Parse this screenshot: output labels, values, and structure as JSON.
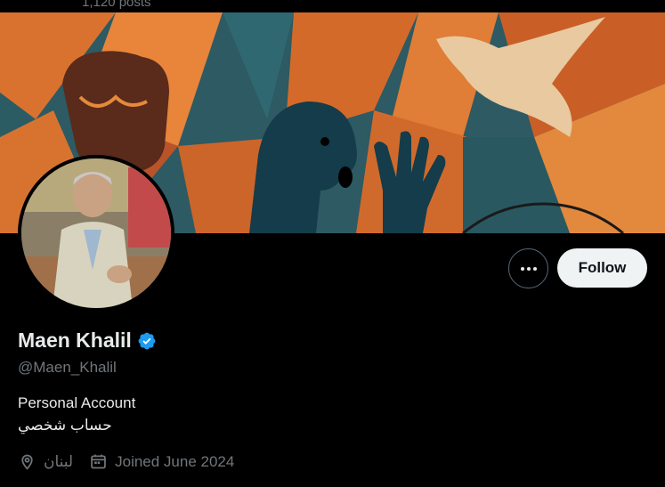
{
  "header": {
    "post_count": "1,120 posts"
  },
  "profile": {
    "display_name": "Maen Khalil",
    "handle": "@Maen_Khalil",
    "verified": true,
    "bio": [
      "Personal Account",
      "حساب شخصي"
    ],
    "location": "لبنان",
    "joined": "Joined June 2024"
  },
  "actions": {
    "follow_label": "Follow",
    "more_icon": "more-horizontal-icon"
  },
  "colors": {
    "background": "#000000",
    "primary_text": "#e7e9ea",
    "secondary_text": "#71767b",
    "verified_blue": "#1d9bf0",
    "follow_bg": "#eff3f4"
  }
}
